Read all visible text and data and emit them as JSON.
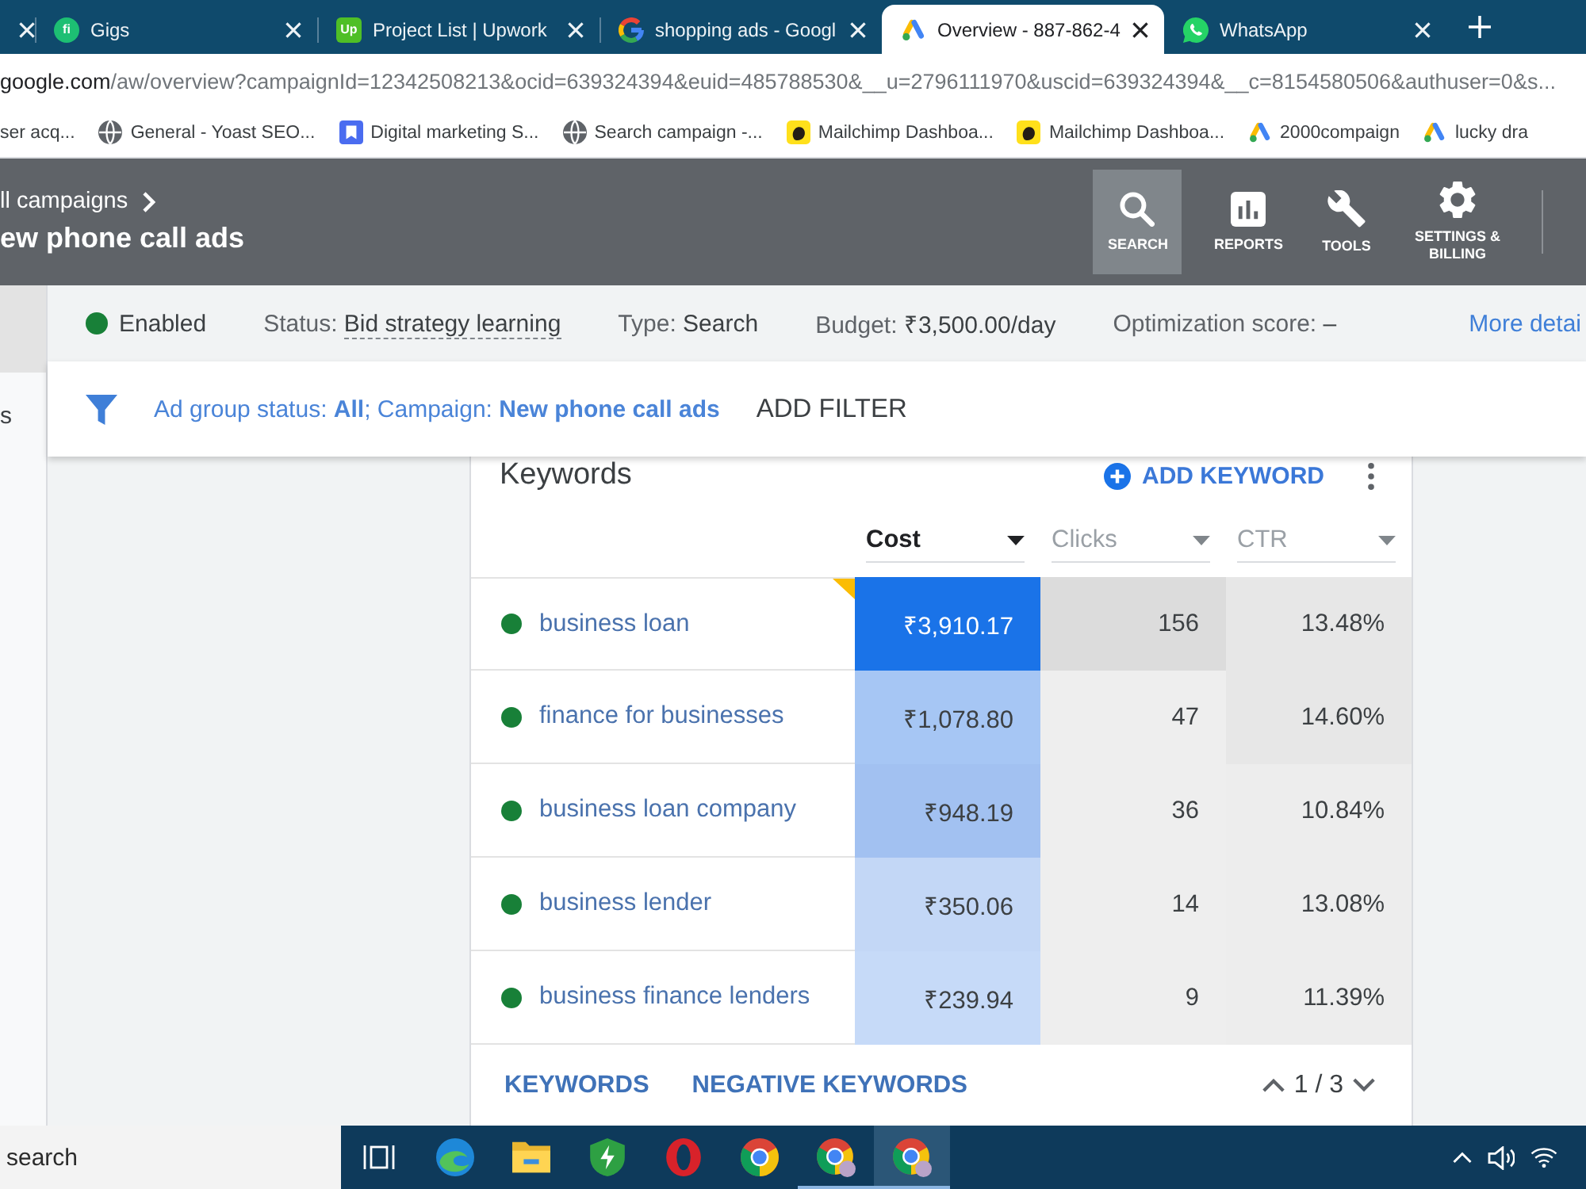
{
  "browser": {
    "tabs": [
      {
        "selected": false
      },
      {
        "title": "Gigs",
        "selected": false,
        "favicon": {
          "kind": "round",
          "text": "fi"
        }
      },
      {
        "title": "Project List | Upwork",
        "selected": false,
        "favicon": {
          "kind": "square",
          "text": "Up"
        }
      },
      {
        "title": "shopping ads - Googl",
        "selected": false,
        "favicon": {
          "kind": "ring"
        }
      },
      {
        "title": "Overview - 887-862-4",
        "selected": true,
        "favicon": {
          "kind": "peaks"
        }
      },
      {
        "title": "WhatsApp",
        "selected": false,
        "favicon": {
          "kind": "bubble"
        }
      }
    ],
    "address": {
      "host": "google.com",
      "path": "/aw/overview?campaignId=12342508213&ocid=639324394&euid=485788530&__u=2796111970&uscid=639324394&__c=8154580506&authuser=0&s..."
    },
    "bookmarks": [
      {
        "title": "ser acq..."
      },
      {
        "title": "General - Yoast SEO...",
        "kind": "globe"
      },
      {
        "title": "Digital marketing S...",
        "kind": "bookmark"
      },
      {
        "title": "Search campaign -...",
        "kind": "globe"
      },
      {
        "title": "Mailchimp Dashboa...",
        "kind": "tile"
      },
      {
        "title": "Mailchimp Dashboa...",
        "kind": "tile"
      },
      {
        "title": "2000compaign",
        "kind": "peaks"
      },
      {
        "title": "lucky dra",
        "kind": "peaks"
      }
    ]
  },
  "header": {
    "breadcrumb": "ll campaigns",
    "title": "ew phone call ads",
    "nav": [
      {
        "kind": "search",
        "label": "SEARCH",
        "selected": true
      },
      {
        "kind": "reports",
        "label": "REPORTS",
        "selected": false
      },
      {
        "kind": "tools",
        "label": "TOOLS",
        "selected": false
      },
      {
        "kind": "settings",
        "label": "SETTINGS & BILLING",
        "selected": false
      }
    ]
  },
  "sidebar": {
    "items": [
      {
        "selected": true
      },
      {
        "label": "s",
        "selected": false
      }
    ]
  },
  "summary": {
    "status": {
      "label": "Enabled",
      "color": "#188038"
    },
    "fields": [
      {
        "label": "Status:",
        "value": "Bid strategy learning",
        "kind": "hint"
      },
      {
        "label": "Type:",
        "value": "Search",
        "kind": "plain"
      },
      {
        "label": "Budget:",
        "value": "₹3,500.00/day",
        "kind": "plain"
      },
      {
        "label": "Optimization score:",
        "value": "–",
        "kind": "plain"
      }
    ],
    "link": "More detai"
  },
  "filter": {
    "text": "Ad group status: **All**; Campaign: **New phone call ads**",
    "button": "ADD FILTER"
  },
  "keywords": {
    "title": "Keywords",
    "add_button": "ADD KEYWORD",
    "columns": [
      {
        "label": "Cost",
        "selected": true
      },
      {
        "label": "Clicks",
        "selected": false
      },
      {
        "label": "CTR",
        "selected": false
      }
    ],
    "rows": [
      {
        "keyword": "business loan",
        "color": "#188038",
        "flagged": true,
        "cells": [
          {
            "text": "₹3,910.17",
            "color": "#1a73e8"
          },
          {
            "text": "156",
            "color": "#dcdcdc"
          },
          {
            "text": "13.48%",
            "color": "#e7e7e7"
          }
        ]
      },
      {
        "keyword": "finance for businesses",
        "color": "#188038",
        "flagged": false,
        "cells": [
          {
            "text": "₹1,078.80",
            "color": "#a6c6f4"
          },
          {
            "text": "47",
            "color": "#eeeeee"
          },
          {
            "text": "14.60%",
            "color": "#e7e7e7"
          }
        ]
      },
      {
        "keyword": "business loan company",
        "color": "#188038",
        "flagged": false,
        "cells": [
          {
            "text": "₹948.19",
            "color": "#a2c1f1"
          },
          {
            "text": "36",
            "color": "#eeeeee"
          },
          {
            "text": "10.84%",
            "color": "#ededed"
          }
        ]
      },
      {
        "keyword": "business lender",
        "color": "#188038",
        "flagged": false,
        "cells": [
          {
            "text": "₹350.06",
            "color": "#c3d7f6"
          },
          {
            "text": "14",
            "color": "#eeeeee"
          },
          {
            "text": "13.08%",
            "color": "#ededed"
          }
        ]
      },
      {
        "keyword": "business finance lenders",
        "color": "#188038",
        "flagged": false,
        "cells": [
          {
            "text": "₹239.94",
            "color": "#c6daf8"
          },
          {
            "text": "9",
            "color": "#eeeeee"
          },
          {
            "text": "11.39%",
            "color": "#ededed"
          }
        ]
      }
    ],
    "footer_tabs": [
      "KEYWORDS",
      "NEGATIVE KEYWORDS"
    ],
    "pager": "1 / 3"
  },
  "taskbar": {
    "search": {
      "placeholder": "search"
    },
    "apps": [
      {
        "kind": "taskview",
        "running": false,
        "selected": false
      },
      {
        "kind": "swirl",
        "running": false,
        "selected": false
      },
      {
        "kind": "folder",
        "running": false,
        "selected": false
      },
      {
        "kind": "shield",
        "running": false,
        "selected": false
      },
      {
        "kind": "oring",
        "running": false,
        "selected": false
      },
      {
        "kind": "segments",
        "running": false,
        "selected": false
      },
      {
        "kind": "segments-badge",
        "running": true,
        "selected": false
      },
      {
        "kind": "segments-badge",
        "running": true,
        "selected": true
      }
    ]
  }
}
